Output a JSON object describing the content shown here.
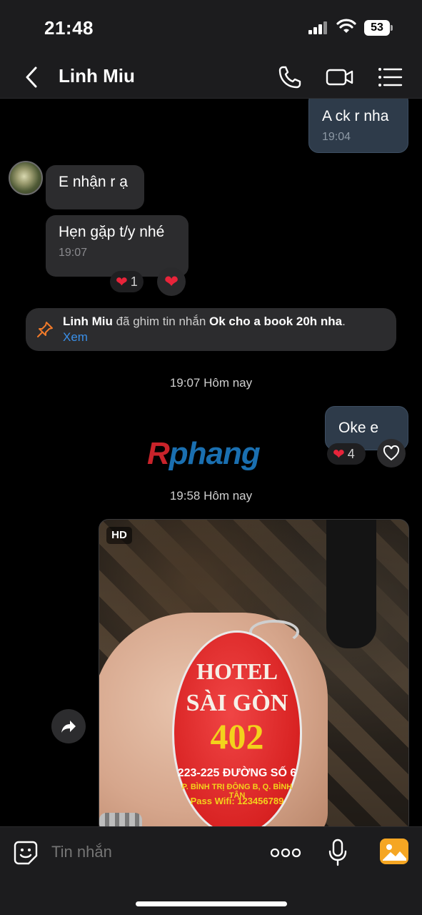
{
  "status_bar": {
    "time": "21:48",
    "battery": "53"
  },
  "header": {
    "contact_name": "Linh Miu"
  },
  "messages": [
    {
      "id": "m1",
      "direction": "out",
      "text": "A ck r nha",
      "time": "19:04"
    },
    {
      "id": "m2",
      "direction": "in",
      "text": "E nhận r ạ"
    },
    {
      "id": "m3",
      "direction": "in",
      "text": "Hẹn gặp t/y nhé",
      "time": "19:07",
      "reaction_count": "1"
    },
    {
      "id": "m4",
      "direction": "out",
      "text": "Oke e",
      "reaction_count": "4"
    }
  ],
  "pin_banner": {
    "actor": "Linh Miu",
    "action": " đã ghim tin nhắn ",
    "pinned_message": "Ok  cho a book 20h nha",
    "suffix": ".",
    "link": "Xem"
  },
  "separators": {
    "first": "19:07 Hôm nay",
    "second": "19:58 Hôm nay"
  },
  "watermark": {
    "first_letter": "R",
    "rest": "phang"
  },
  "photo": {
    "badge": "HD",
    "keytag_lines": {
      "hotel": "HOTEL",
      "name": "SÀI GÒN",
      "room": "402",
      "address": "223-225 ĐƯỜNG SỐ 6",
      "ward": "P. BÌNH TRỊ ĐÔNG B, Q. BÌNH TÂN",
      "wifi": "Pass Wifi: 123456789"
    }
  },
  "input_bar": {
    "placeholder": "Tin nhắn"
  },
  "colors": {
    "accent": "#3a8fe8",
    "heart": "#e8243a",
    "outgoing_bubble": "#2e3b4a",
    "incoming_bubble": "#2c2c2e",
    "gallery": "#f5a623"
  }
}
